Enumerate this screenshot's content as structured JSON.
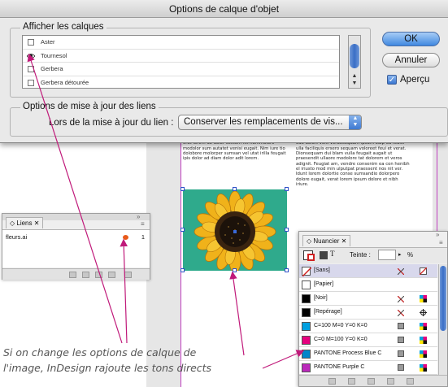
{
  "dialog": {
    "title": "Options de calque d'objet",
    "show_layers_label": "Afficher les calques",
    "layers": [
      {
        "name": "Aster",
        "visible": false
      },
      {
        "name": "Tournesol",
        "visible": true
      },
      {
        "name": "Gerbera",
        "visible": false
      },
      {
        "name": "Gerbera détourée",
        "visible": false
      }
    ],
    "ok_label": "OK",
    "cancel_label": "Annuler",
    "preview_label": "Aperçu",
    "preview_checked": true,
    "links_group_label": "Options de mise à jour des liens",
    "on_update_label": "Lors de la mise à jour du lien :",
    "on_update_value": "Conserver les remplacements de vis..."
  },
  "document": {
    "col1_text": "ulputat lorem aliquam commy nulla faciliquis nullummodit velessim dolobor tionsecte vel utat. Ut volore digna faci blan aliquipit lorem aliquis nim enibh ex eu facilit ipsum iriure volorpe reriliquam quis dolum. Duis nostrud dui te ex erat lorem do dolor sectem ilit nummolore modolor sum autatet venisi eugait. Nim iure tio dolobore molorper sumsan vel utat irilla feugait ipis dolor ad diam dolor adit lorem.",
    "col2_text": "augiatie vel dolore dolorerit iuscipis alis nim augait utpat lorem ipsum. Mincil utatem nim iliusquit ex eu feu facil blandio con henim enim in hendiam doluptat. Reetue tem et lorem iuscipis ullan doloreetuer lorper dolobor percidunt nostio odiodolo odo dolort velit veraesequam ipsum odip ea feuisi ulla faciliquis ersero sequam voloreet feui et verat. Dionsequam dui blam vulla feugait augait ut praesendit ullaore modolore tat dolorem et veros adignit. Feugiat am, vendre consenim ea con henibh el iriusto mod min ulputpat praessent nos nit ver. Idunt lorem dolortie conse sumsandio dolorpero dolore eugait, verat lorem ipsum dolore et nibh iriure."
  },
  "links_panel": {
    "tab_label": "Liens",
    "file_name": "fleurs.ai",
    "page_number": "1"
  },
  "swatches_panel": {
    "tab_label": "Nuancier",
    "tint_label": "Teinte :",
    "tint_value": "",
    "percent": "%",
    "swatches": [
      {
        "name": "[Sans]",
        "color": "#ffffff",
        "none": true
      },
      {
        "name": "[Papier]",
        "color": "#ffffff"
      },
      {
        "name": "[Noir]",
        "color": "#000000"
      },
      {
        "name": "[Repérage]",
        "color": "#000000"
      },
      {
        "name": "C=100 M=0 Y=0 K=0",
        "color": "#00a0e0"
      },
      {
        "name": "C=0 M=100 Y=0 K=0",
        "color": "#e6007e"
      },
      {
        "name": "PANTONE Process Blue C",
        "color": "#0085ca"
      },
      {
        "name": "PANTONE Purple C",
        "color": "#bb29bb"
      }
    ]
  },
  "caption": {
    "line1": "Si on change les options de calque de",
    "line2": "l'image, InDesign rajoute les tons directs"
  },
  "colors": {
    "image_background": "#2faa8c",
    "arrow": "#c01a7a",
    "ok_button": "#3f88e0"
  }
}
